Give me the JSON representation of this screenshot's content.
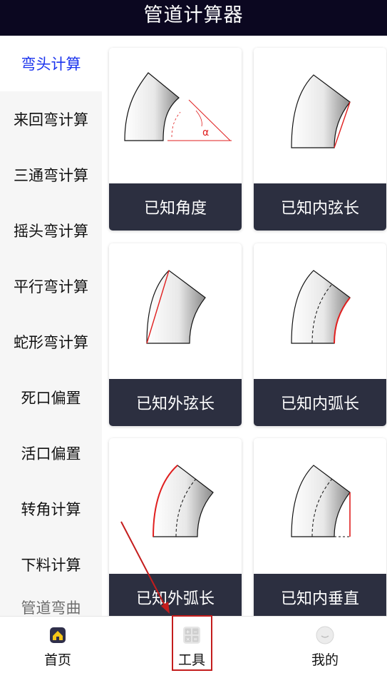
{
  "header": {
    "title": "管道计算器"
  },
  "sidebar": {
    "items": [
      {
        "label": "弯头计算",
        "active": true
      },
      {
        "label": "来回弯计算"
      },
      {
        "label": "三通弯计算"
      },
      {
        "label": "摇头弯计算"
      },
      {
        "label": "平行弯计算"
      },
      {
        "label": "蛇形弯计算"
      },
      {
        "label": "死口偏置"
      },
      {
        "label": "活口偏置"
      },
      {
        "label": "转角计算"
      },
      {
        "label": "下料计算"
      },
      {
        "label": "管道弯曲"
      }
    ]
  },
  "cards": [
    {
      "label": "已知角度",
      "icon": "elbow-angle-diagram"
    },
    {
      "label": "已知内弦长",
      "icon": "elbow-inner-chord-diagram"
    },
    {
      "label": "已知外弦长",
      "icon": "elbow-outer-chord-diagram"
    },
    {
      "label": "已知内弧长",
      "icon": "elbow-inner-arc-diagram"
    },
    {
      "label": "已知外弧长",
      "icon": "elbow-outer-arc-diagram"
    },
    {
      "label": "已知内垂直",
      "icon": "elbow-inner-vertical-diagram"
    }
  ],
  "diagram": {
    "angle_symbol": "α"
  },
  "bottom_nav": {
    "tabs": [
      {
        "label": "首页",
        "icon": "home-icon"
      },
      {
        "label": "工具",
        "icon": "calculator-icon",
        "highlighted": true
      },
      {
        "label": "我的",
        "icon": "smiley-icon"
      }
    ]
  },
  "colors": {
    "header_bg": "#0b0720",
    "active_blue": "#1a33ee",
    "card_label_bg": "#2c2f40",
    "accent_red": "#e01f1f"
  }
}
